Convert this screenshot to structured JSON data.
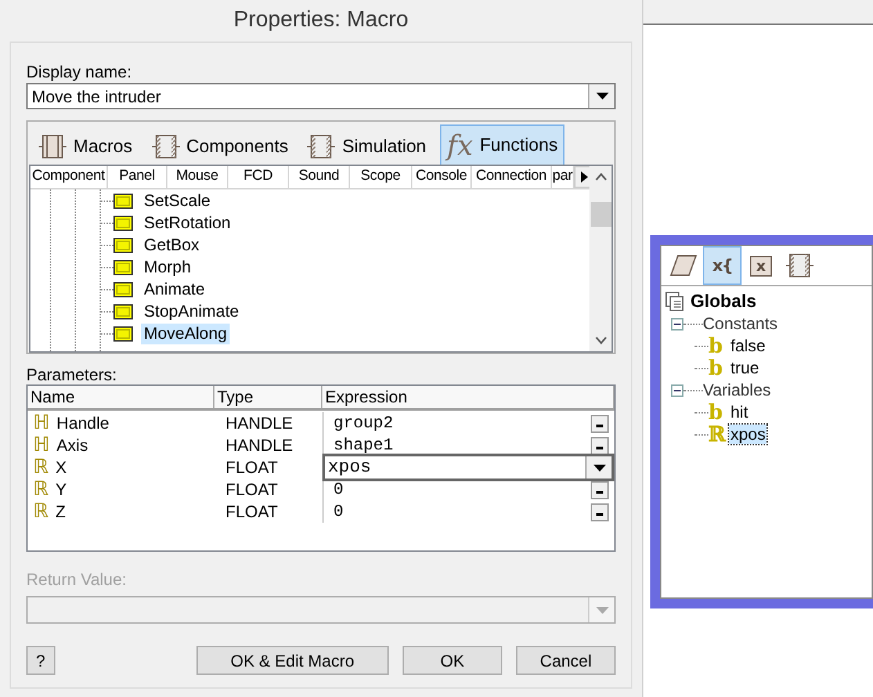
{
  "dialog": {
    "title": "Properties: Macro",
    "display_name": {
      "label": "Display name:",
      "value": "Move the intruder"
    },
    "tabs": [
      {
        "label": "Macros",
        "kind": "component",
        "selected": false
      },
      {
        "label": "Components",
        "kind": "hatched",
        "selected": false
      },
      {
        "label": "Simulation",
        "kind": "hatched",
        "selected": false
      },
      {
        "label": "Functions",
        "kind": "fx",
        "glyph": "fx",
        "selected": true
      }
    ],
    "categories": [
      "Component",
      "Panel",
      "Mouse",
      "FCD",
      "Sound",
      "Scope",
      "Console",
      "Connection",
      "par"
    ],
    "functions": [
      {
        "label": "SetScale",
        "selected": false
      },
      {
        "label": "SetRotation",
        "selected": false
      },
      {
        "label": "GetBox",
        "selected": false
      },
      {
        "label": "Morph",
        "selected": false
      },
      {
        "label": "Animate",
        "selected": false
      },
      {
        "label": "StopAnimate",
        "selected": false
      },
      {
        "label": "MoveAlong",
        "selected": true
      }
    ],
    "parameters": {
      "label": "Parameters:",
      "columns": [
        "Name",
        "Type",
        "Expression"
      ],
      "rows": [
        {
          "icon": "ℍ",
          "name": "Handle",
          "type": "HANDLE",
          "expression": "group2",
          "editing": false
        },
        {
          "icon": "ℍ",
          "name": "Axis",
          "type": "HANDLE",
          "expression": "shape1",
          "editing": false
        },
        {
          "icon": "ℝ",
          "name": "X",
          "type": "FLOAT",
          "expression": "xpos",
          "editing": true
        },
        {
          "icon": "ℝ",
          "name": "Y",
          "type": "FLOAT",
          "expression": "0",
          "editing": false
        },
        {
          "icon": "ℝ",
          "name": "Z",
          "type": "FLOAT",
          "expression": "0",
          "editing": false
        }
      ]
    },
    "return_value": {
      "label": "Return Value:",
      "disabled": true
    },
    "buttons": [
      {
        "label": "?"
      },
      {
        "label": "OK & Edit Macro"
      },
      {
        "label": "OK"
      },
      {
        "label": "Cancel"
      }
    ]
  },
  "globals_panel": {
    "toolbar": [
      {
        "kind": "flowchart",
        "selected": false
      },
      {
        "kind": "variables",
        "glyph": "x{",
        "selected": true
      },
      {
        "kind": "boxed",
        "glyph": "x",
        "selected": false
      },
      {
        "kind": "component",
        "selected": false
      }
    ],
    "tree": {
      "label": "Globals",
      "children": [
        {
          "label": "Constants",
          "expanded": true,
          "children": [
            {
              "label": "false",
              "icon": "b",
              "selected": false
            },
            {
              "label": "true",
              "icon": "b",
              "selected": false
            }
          ]
        },
        {
          "label": "Variables",
          "expanded": true,
          "children": [
            {
              "label": "hit",
              "icon": "b",
              "selected": false
            },
            {
              "label": "xpos",
              "icon": "ℝ",
              "selected": true
            }
          ]
        }
      ]
    }
  }
}
